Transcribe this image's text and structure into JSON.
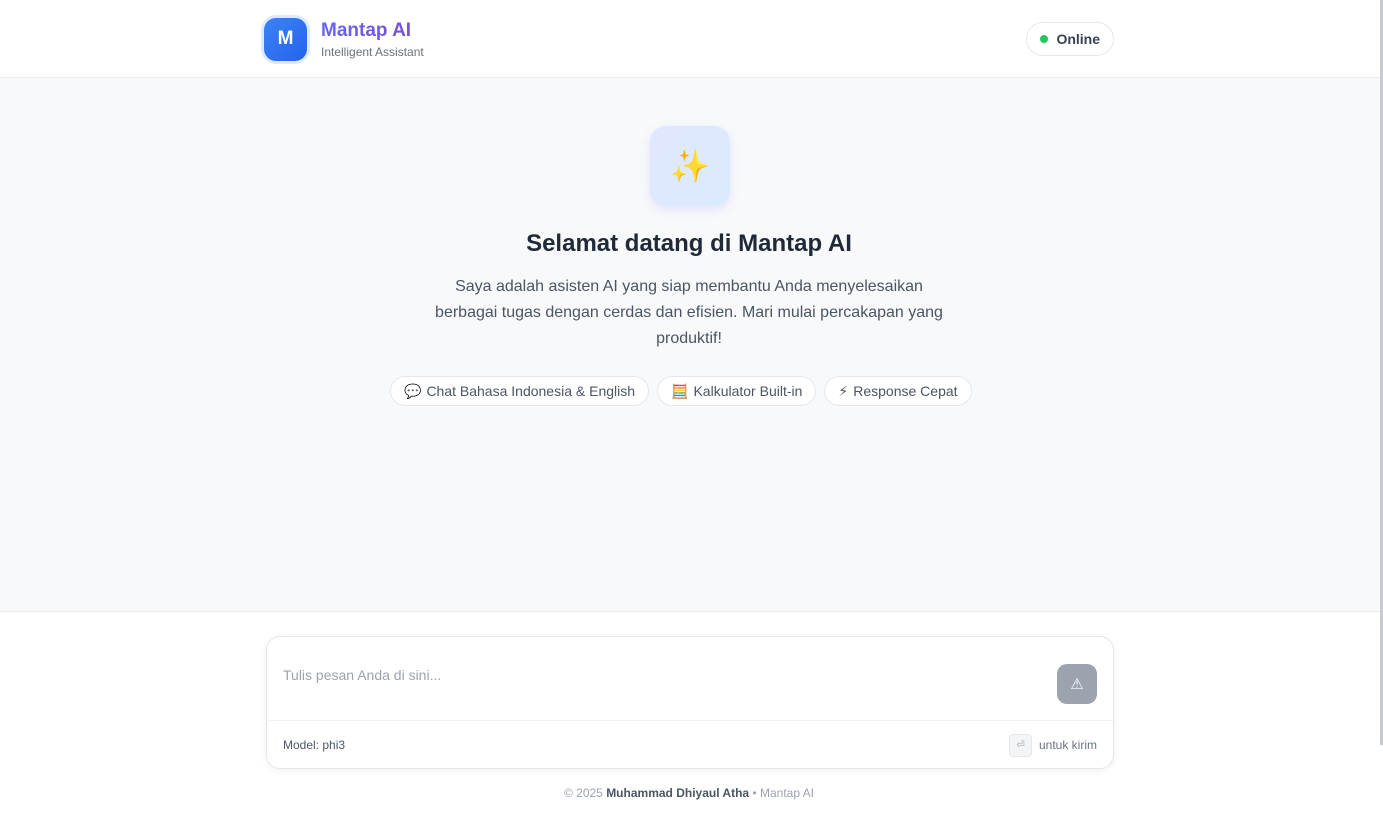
{
  "app": {
    "logo_letter": "M",
    "title": "Mantap AI",
    "subtitle": "Intelligent Assistant",
    "status": "Online",
    "status_color": "#22c55e"
  },
  "hero": {
    "icon": "sparkles-icon",
    "icon_glyph": "✨",
    "title": "Selamat datang di Mantap AI",
    "description": "Saya adalah asisten AI yang siap membantu Anda menyelesaikan berbagai tugas dengan cerdas dan efisien. Mari mulai percakapan yang produktif!"
  },
  "features": [
    {
      "emoji": "💬",
      "label": "Chat Bahasa Indonesia & English"
    },
    {
      "emoji": "🧮",
      "label": "Kalkulator Built-in"
    },
    {
      "emoji": "⚡",
      "label": "Response Cepat"
    }
  ],
  "composer": {
    "placeholder": "Tulis pesan Anda di sini...",
    "value": "",
    "send_icon": "⚠",
    "model_label": "Model: phi3",
    "enter_key": "⏎",
    "hint": "untuk kirim"
  },
  "footer": {
    "copyright": "© 2025",
    "author": "Muhammad Dhiyaul Atha",
    "separator": "•",
    "product": "Mantap AI"
  }
}
